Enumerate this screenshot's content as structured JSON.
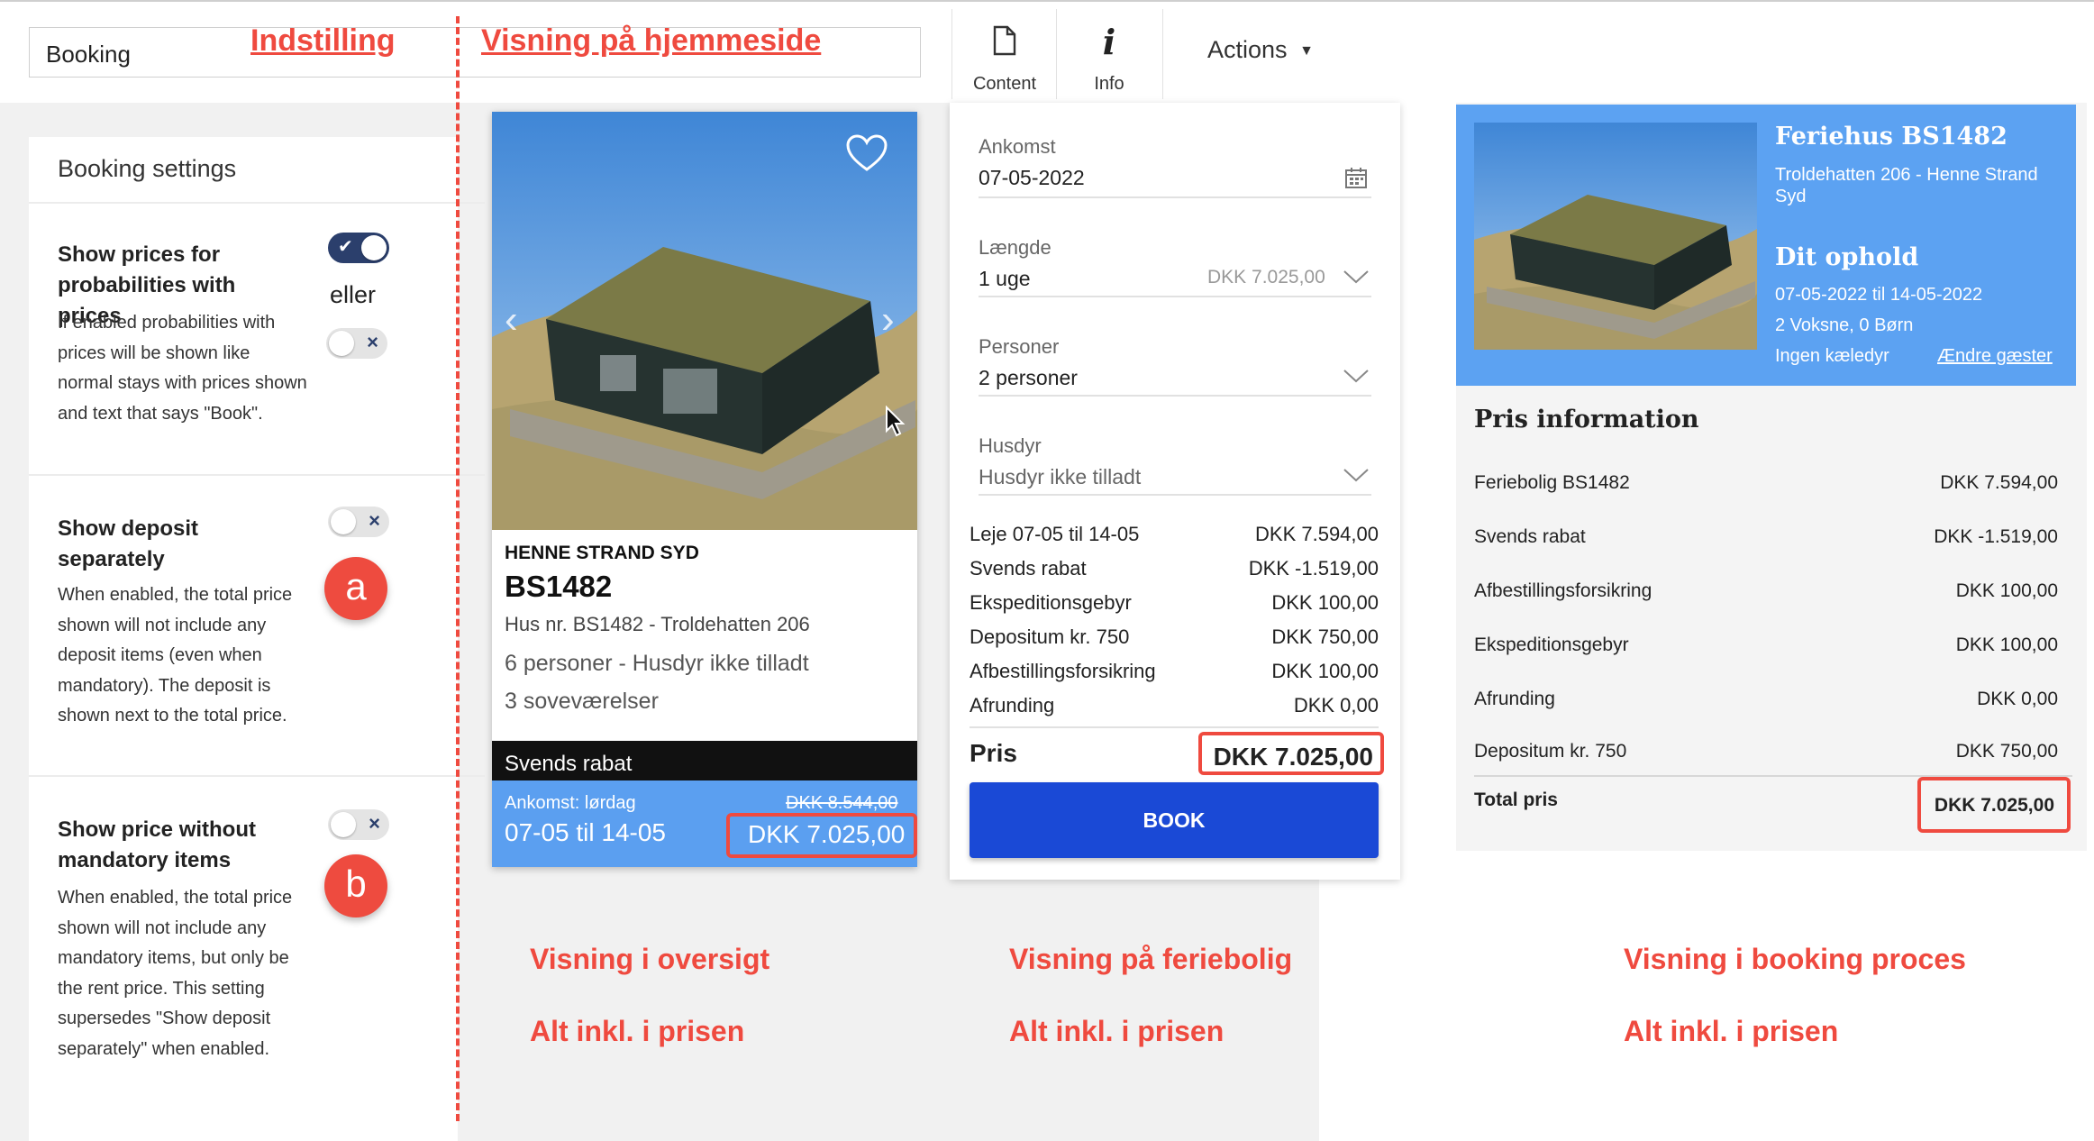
{
  "header": {
    "page_title": "Booking",
    "anno_settings": "Indstilling",
    "anno_display": "Visning på hjemmeside",
    "content_label": "Content",
    "info_label": "Info",
    "actions_label": "Actions"
  },
  "settings": {
    "title": "Booking settings",
    "items": [
      {
        "title": "Show prices for probabilities with prices",
        "desc": "If enabled probabilities with prices will be shown like normal stays with prices shown and text that says \"Book\".",
        "toggle_on": true
      },
      {
        "title": "Show deposit separately",
        "desc": "When enabled, the total price shown will not include any deposit items (even when mandatory). The deposit is shown next to the total price.",
        "toggle_on": false,
        "badge": "a"
      },
      {
        "title": "Show price without mandatory items",
        "desc": "When enabled, the total price shown will not include any mandatory items, but only be the rent price. This setting supersedes \"Show deposit separately\" when enabled.",
        "toggle_on": false,
        "badge": "b"
      }
    ],
    "eller": "eller"
  },
  "card": {
    "location": "HENNE STRAND SYD",
    "code": "BS1482",
    "address": "Hus nr. BS1482 - Troldehatten 206",
    "persons": "6 personer - Husdyr ikke tilladt",
    "rooms": "3 soveværelser",
    "discount": "Svends rabat",
    "arrival": "Ankomst: lørdag",
    "dates": "07-05 til 14-05",
    "old_price": "DKK 8.544,00",
    "price": "DKK 7.025,00"
  },
  "form": {
    "ankomst_label": "Ankomst",
    "ankomst_value": "07-05-2022",
    "laengde_label": "Længde",
    "laengde_value": "1 uge",
    "laengde_price": "DKK 7.025,00",
    "personer_label": "Personer",
    "personer_value": "2 personer",
    "husdyr_label": "Husdyr",
    "husdyr_value": "Husdyr ikke tilladt",
    "lines": [
      {
        "label": "Leje 07-05 til 14-05",
        "value": "DKK 7.594,00"
      },
      {
        "label": "Svends rabat",
        "value": "DKK -1.519,00"
      },
      {
        "label": "Ekspeditionsgebyr",
        "value": "DKK 100,00"
      },
      {
        "label": "Depositum kr. 750",
        "value": "DKK 750,00"
      },
      {
        "label": "Afbestillingsforsikring",
        "value": "DKK 100,00"
      },
      {
        "label": "Afrunding",
        "value": "DKK 0,00"
      }
    ],
    "pris_label": "Pris",
    "pris_value": "DKK 7.025,00",
    "book_label": "BOOK"
  },
  "process": {
    "title": "Feriehus BS1482",
    "address": "Troldehatten 206 - Henne Strand Syd",
    "stay_title": "Dit ophold",
    "dates": "07-05-2022 til 14-05-2022",
    "guests": "2 Voksne, 0 Børn",
    "pets": "Ingen kæledyr",
    "change_guests": "Ændre gæster",
    "info_title": "Pris information",
    "lines": [
      {
        "label": "Feriebolig BS1482",
        "value": "DKK 7.594,00"
      },
      {
        "label": "Svends rabat",
        "value": "DKK -1.519,00"
      },
      {
        "label": "Afbestillingsforsikring",
        "value": "DKK 100,00"
      },
      {
        "label": "Ekspeditionsgebyr",
        "value": "DKK 100,00"
      },
      {
        "label": "Afrunding",
        "value": "DKK 0,00"
      },
      {
        "label": "Depositum kr. 750",
        "value": "DKK 750,00"
      }
    ],
    "total_label": "Total pris",
    "total_value": "DKK 7.025,00"
  },
  "annotations": {
    "overview": "Visning i oversigt",
    "holiday_home": "Visning på feriebolig",
    "booking_process": "Visning i booking proces",
    "included_1": "Alt inkl. i prisen",
    "included_2": "Alt inkl. i prisen",
    "included_3": "Alt inkl. i prisen"
  },
  "icons": {
    "content": "document-icon",
    "info": "info-icon",
    "calendar": "calendar-icon",
    "heart": "heart-icon",
    "chevron": "chevron-down-icon"
  },
  "colors": {
    "accent_red": "#ef4a3f",
    "book_blue": "#1a49d6",
    "toggle_navy": "#2b3f6c",
    "price_bar": "#5b9ff0"
  }
}
